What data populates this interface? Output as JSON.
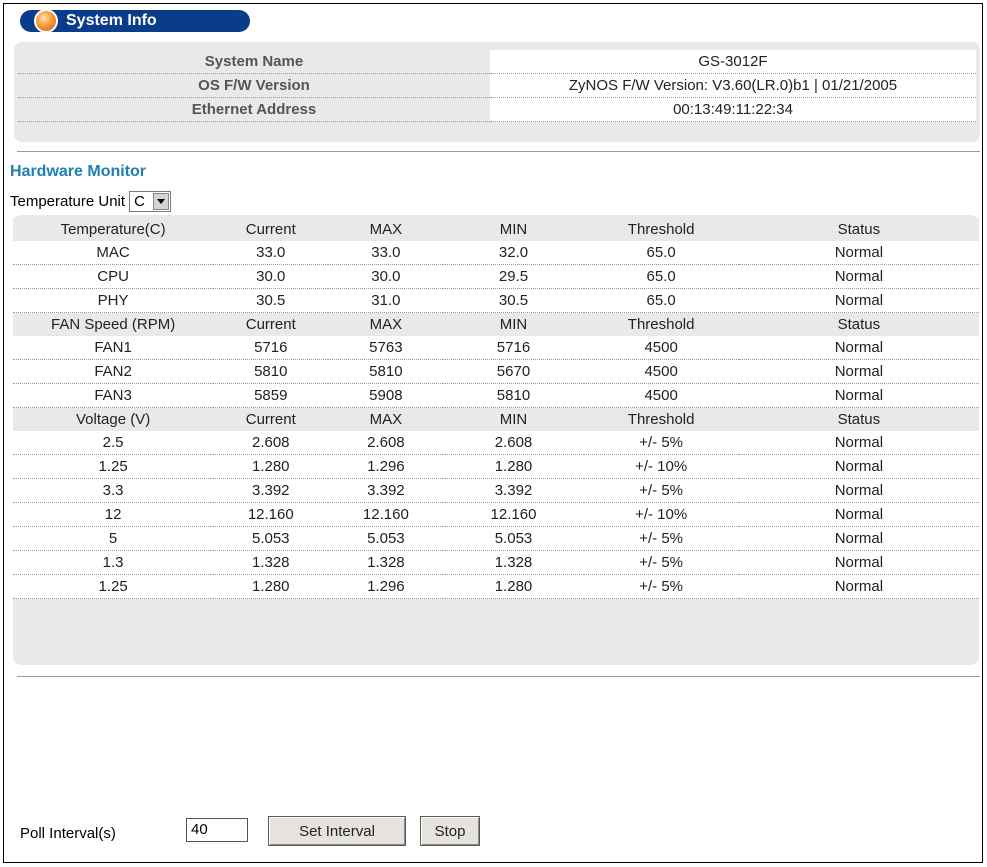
{
  "header": {
    "title": "System Info"
  },
  "system_info": [
    {
      "label": "System Name",
      "value": "GS-3012F"
    },
    {
      "label": "OS F/W Version",
      "value": "ZyNOS F/W Version: V3.60(LR.0)b1 | 01/21/2005"
    },
    {
      "label": "Ethernet Address",
      "value": "00:13:49:11:22:34"
    }
  ],
  "hardware_monitor": {
    "title": "Hardware Monitor",
    "temp_unit_label": "Temperature Unit",
    "temp_unit_value": "C",
    "sections": [
      {
        "header": [
          "Temperature(C)",
          "Current",
          "MAX",
          "MIN",
          "Threshold",
          "Status"
        ],
        "rows": [
          [
            "MAC",
            "33.0",
            "33.0",
            "32.0",
            "65.0",
            "Normal"
          ],
          [
            "CPU",
            "30.0",
            "30.0",
            "29.5",
            "65.0",
            "Normal"
          ],
          [
            "PHY",
            "30.5",
            "31.0",
            "30.5",
            "65.0",
            "Normal"
          ]
        ]
      },
      {
        "header": [
          "FAN Speed (RPM)",
          "Current",
          "MAX",
          "MIN",
          "Threshold",
          "Status"
        ],
        "rows": [
          [
            "FAN1",
            "5716",
            "5763",
            "5716",
            "4500",
            "Normal"
          ],
          [
            "FAN2",
            "5810",
            "5810",
            "5670",
            "4500",
            "Normal"
          ],
          [
            "FAN3",
            "5859",
            "5908",
            "5810",
            "4500",
            "Normal"
          ]
        ]
      },
      {
        "header": [
          "Voltage (V)",
          "Current",
          "MAX",
          "MIN",
          "Threshold",
          "Status"
        ],
        "rows": [
          [
            "2.5",
            "2.608",
            "2.608",
            "2.608",
            "+/- 5%",
            "Normal"
          ],
          [
            "1.25",
            "1.280",
            "1.296",
            "1.280",
            "+/- 10%",
            "Normal"
          ],
          [
            "3.3",
            "3.392",
            "3.392",
            "3.392",
            "+/- 5%",
            "Normal"
          ],
          [
            "12",
            "12.160",
            "12.160",
            "12.160",
            "+/- 10%",
            "Normal"
          ],
          [
            "5",
            "5.053",
            "5.053",
            "5.053",
            "+/- 5%",
            "Normal"
          ],
          [
            "1.3",
            "1.328",
            "1.328",
            "1.328",
            "+/- 5%",
            "Normal"
          ],
          [
            "1.25",
            "1.280",
            "1.296",
            "1.280",
            "+/- 5%",
            "Normal"
          ]
        ]
      }
    ]
  },
  "poll": {
    "label": "Poll Interval(s)",
    "value": "40",
    "set_label": "Set Interval",
    "stop_label": "Stop"
  },
  "colors": {
    "title_bar": "#0a3c8c",
    "section_title": "#1f7fb0",
    "panel": "#e9e9e9"
  }
}
